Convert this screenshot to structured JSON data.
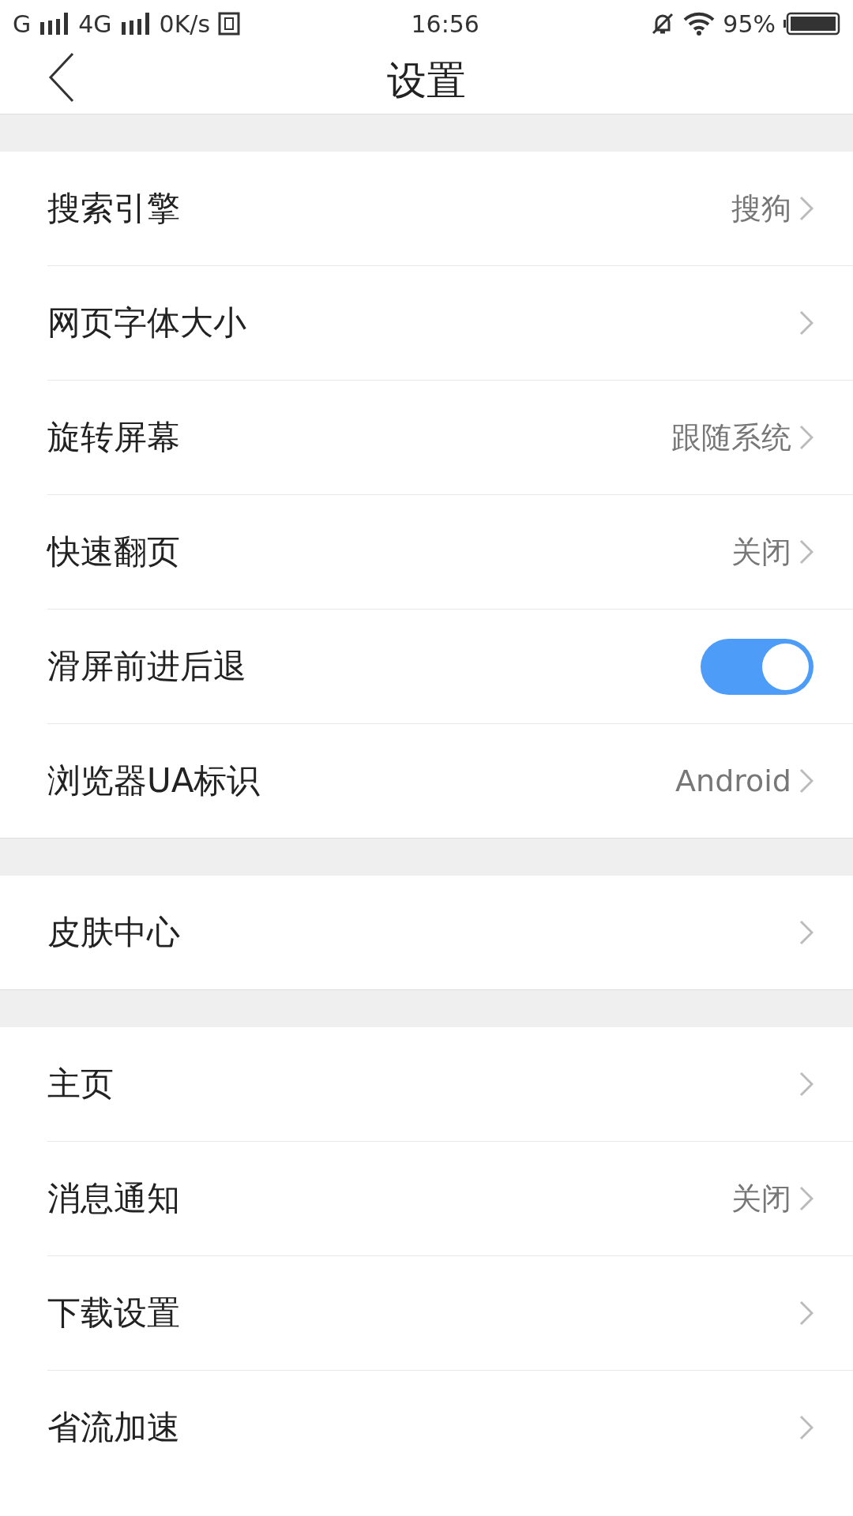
{
  "status_bar": {
    "network_1": "G",
    "network_2": "4G",
    "speed": "0K/s",
    "time": "16:56",
    "battery": "95%"
  },
  "header": {
    "title": "设置"
  },
  "sections": [
    {
      "rows": [
        {
          "kind": "link",
          "label": "搜索引擎",
          "value": "搜狗"
        },
        {
          "kind": "link",
          "label": "网页字体大小"
        },
        {
          "kind": "link",
          "label": "旋转屏幕",
          "value": "跟随系统"
        },
        {
          "kind": "link",
          "label": "快速翻页",
          "value": "关闭"
        },
        {
          "kind": "toggle",
          "label": "滑屏前进后退",
          "on": true
        },
        {
          "kind": "link",
          "label": "浏览器UA标识",
          "value": "Android"
        }
      ]
    },
    {
      "rows": [
        {
          "kind": "link",
          "label": "皮肤中心"
        }
      ]
    },
    {
      "rows": [
        {
          "kind": "link",
          "label": "主页"
        },
        {
          "kind": "link",
          "label": "消息通知",
          "value": "关闭"
        },
        {
          "kind": "link",
          "label": "下载设置"
        },
        {
          "kind": "link",
          "label": "省流加速"
        }
      ]
    }
  ]
}
